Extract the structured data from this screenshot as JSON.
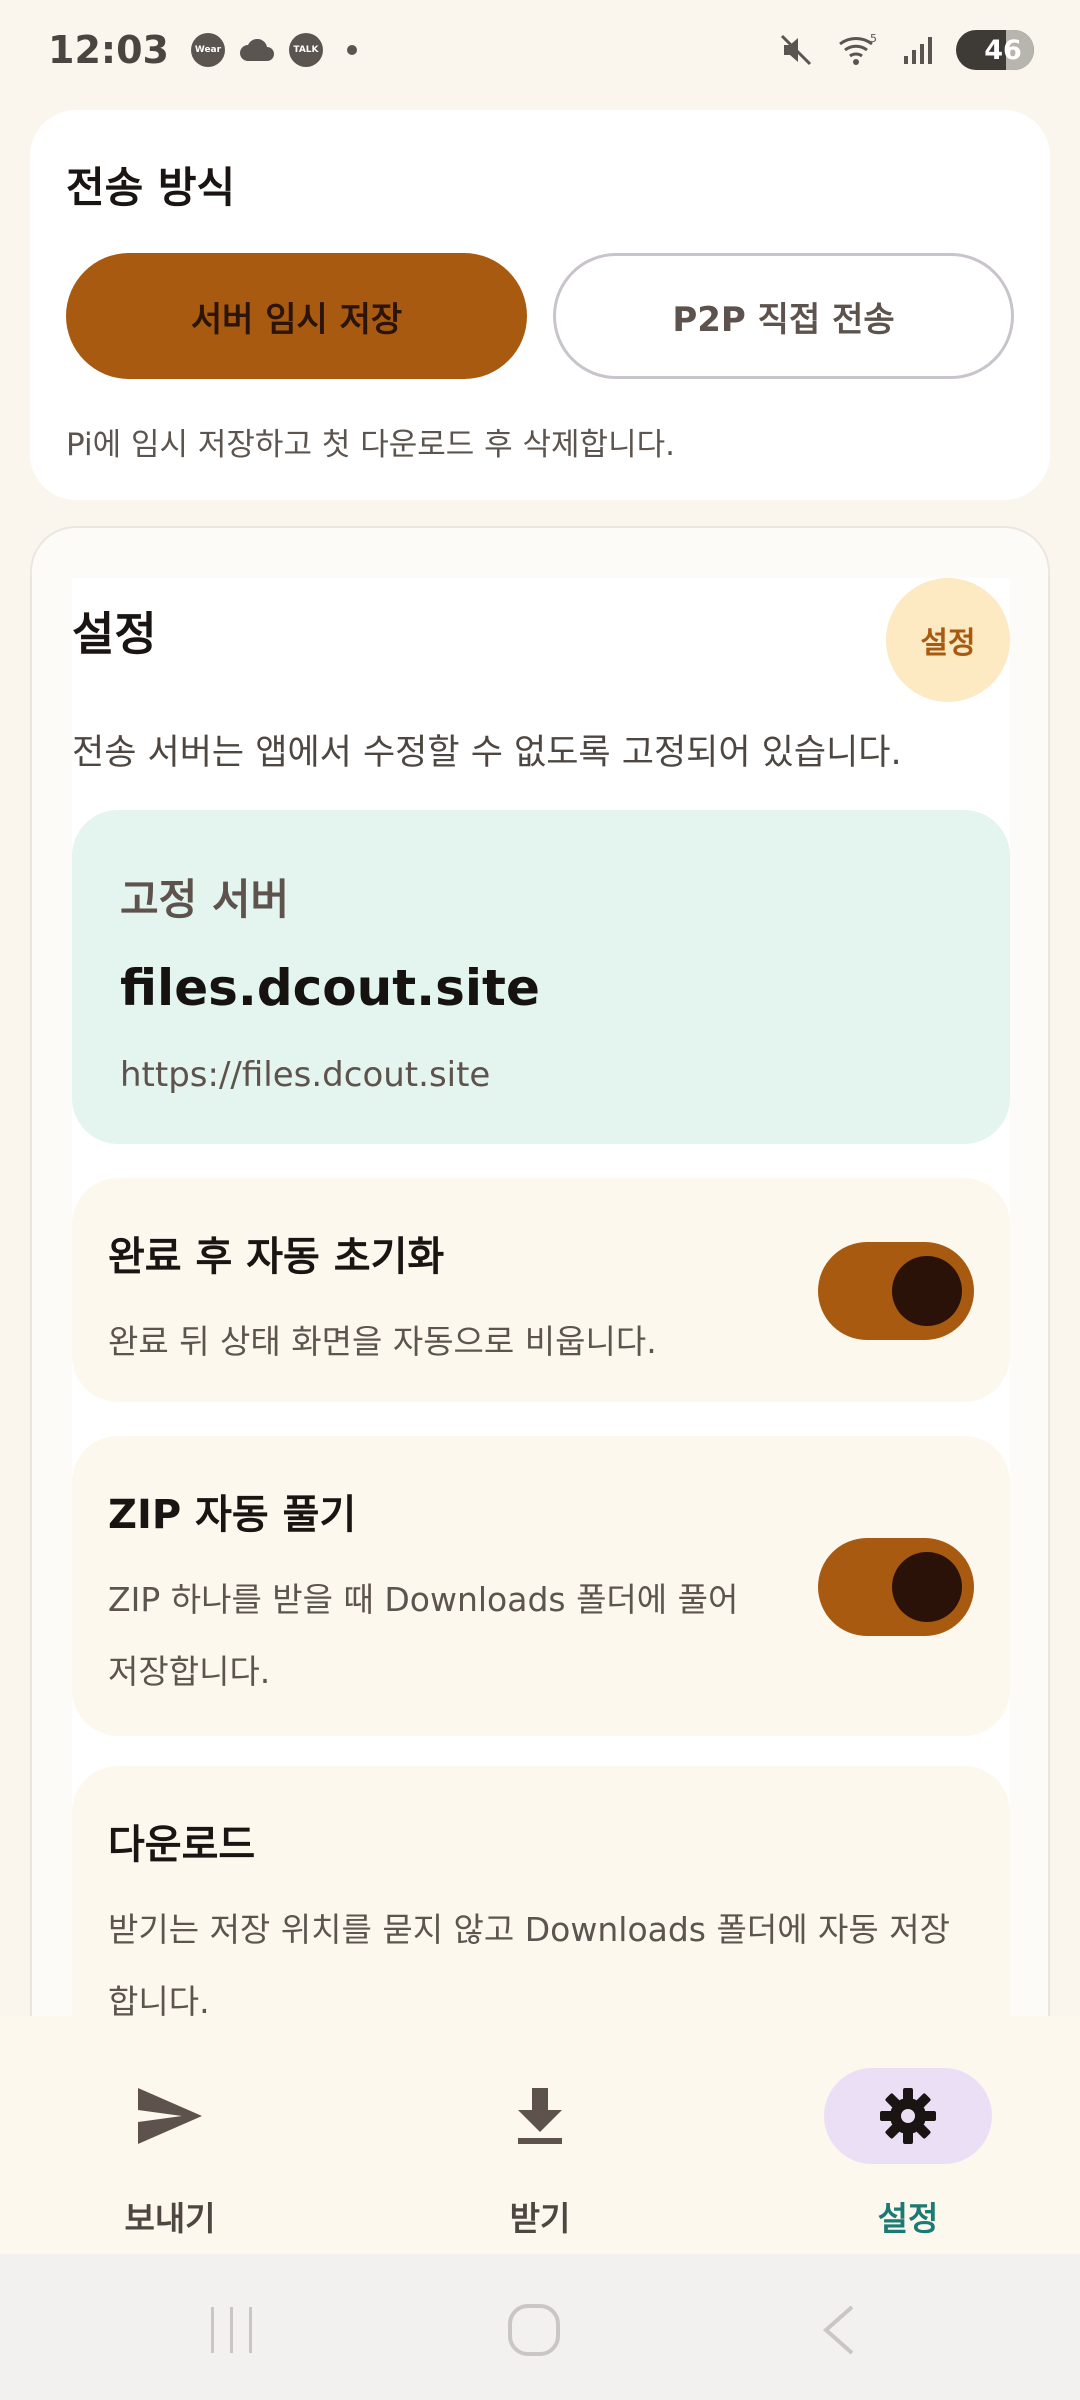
{
  "status_bar": {
    "time": "12:03",
    "app_chips": [
      "Wear",
      "TALK"
    ],
    "battery": "46",
    "signal_label": "5"
  },
  "transfer_mode": {
    "title": "전송 방식",
    "options": [
      {
        "label": "서버 임시 저장",
        "selected": true
      },
      {
        "label": "P2P 직접 전송",
        "selected": false
      }
    ],
    "description": "Pi에 임시 저장하고 첫 다운로드 후 삭제합니다."
  },
  "settings": {
    "title": "설정",
    "badge": "설정",
    "description": "전송 서버는 앱에서 수정할 수 없도록 고정되어 있습니다.",
    "server": {
      "label": "고정 서버",
      "host": "files.dcout.site",
      "url": "https://files.dcout.site"
    },
    "options": [
      {
        "title": "완료 후 자동 초기화",
        "description": "완료 뒤 상태 화면을 자동으로 비웁니다.",
        "enabled": true
      },
      {
        "title": "ZIP 자동 풀기",
        "description": "ZIP 하나를 받을 때 Downloads 폴더에 풀어 저장합니다.",
        "enabled": true
      },
      {
        "title": "다운로드",
        "description": "받기는 저장 위치를 묻지 않고 Downloads 폴더에 자동 저장합니다."
      }
    ]
  },
  "bottom_nav": {
    "items": [
      {
        "label": "보내기",
        "icon": "send-icon",
        "active": false
      },
      {
        "label": "받기",
        "icon": "download-icon",
        "active": false
      },
      {
        "label": "설정",
        "icon": "gear-icon",
        "active": true
      }
    ]
  },
  "colors": {
    "accent": "#a85a10",
    "active_nav_label": "#1b7a72",
    "active_nav_pill": "#eadff5",
    "server_box": "#e4f4ef",
    "badge_bg": "#fde9c2"
  }
}
